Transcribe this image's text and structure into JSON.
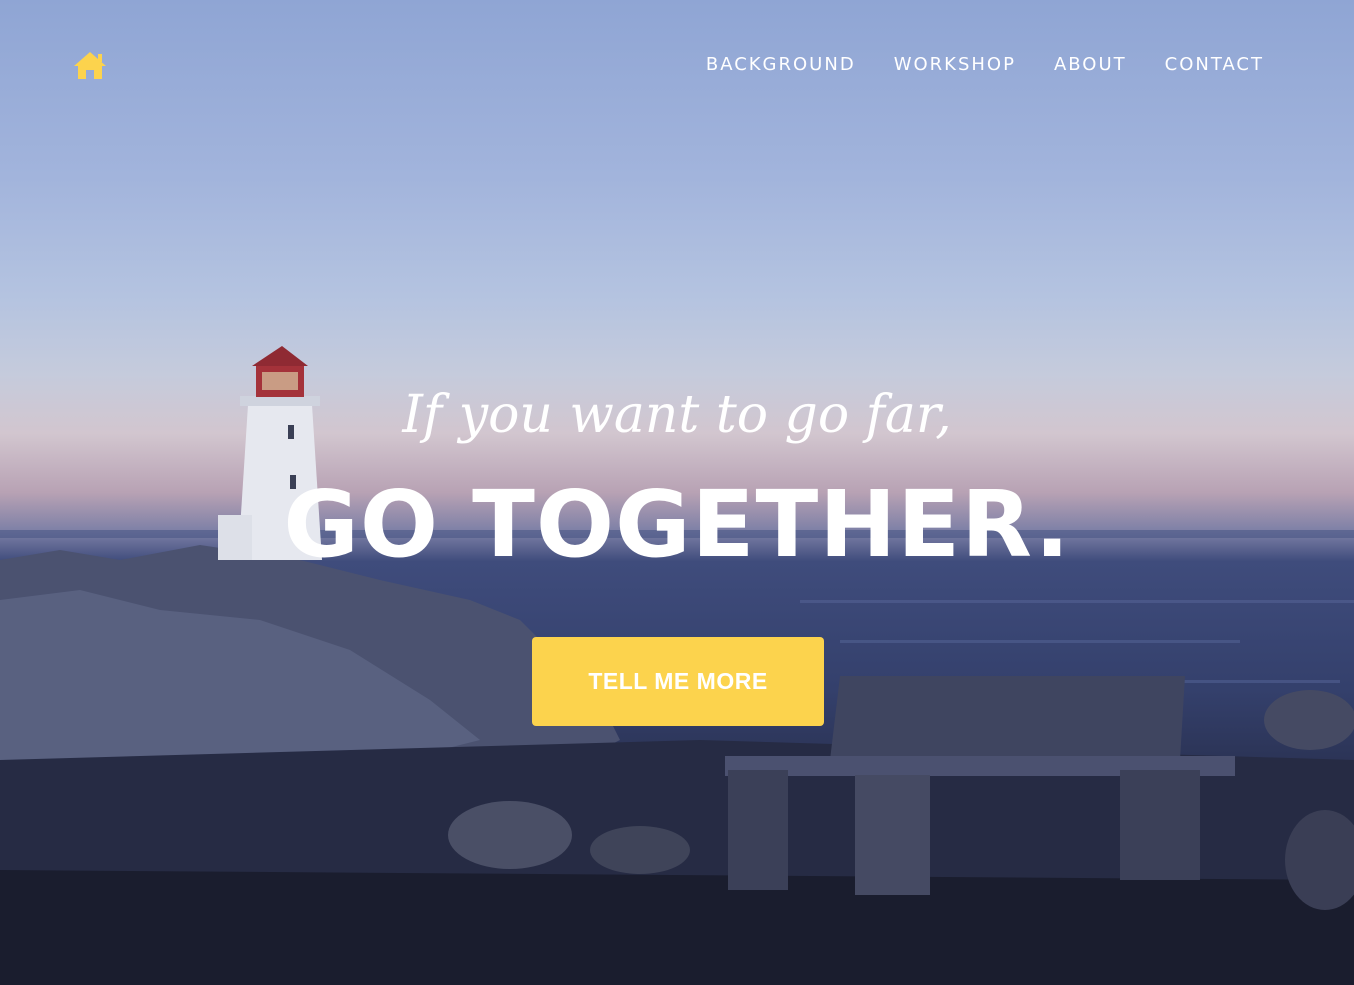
{
  "nav": {
    "home_icon": "home-icon",
    "links": [
      {
        "label": "BACKGROUND"
      },
      {
        "label": "WORKSHOP"
      },
      {
        "label": "ABOUT"
      },
      {
        "label": "CONTACT"
      }
    ]
  },
  "hero": {
    "lead_in": "If you want to go far,",
    "heading": "GO TOGETHER.",
    "button_label": "TELL ME MORE"
  },
  "colors": {
    "accent": "#fcd34d",
    "text": "#ffffff",
    "sky_top": "#8fa5d4",
    "sea": "#34406c"
  }
}
